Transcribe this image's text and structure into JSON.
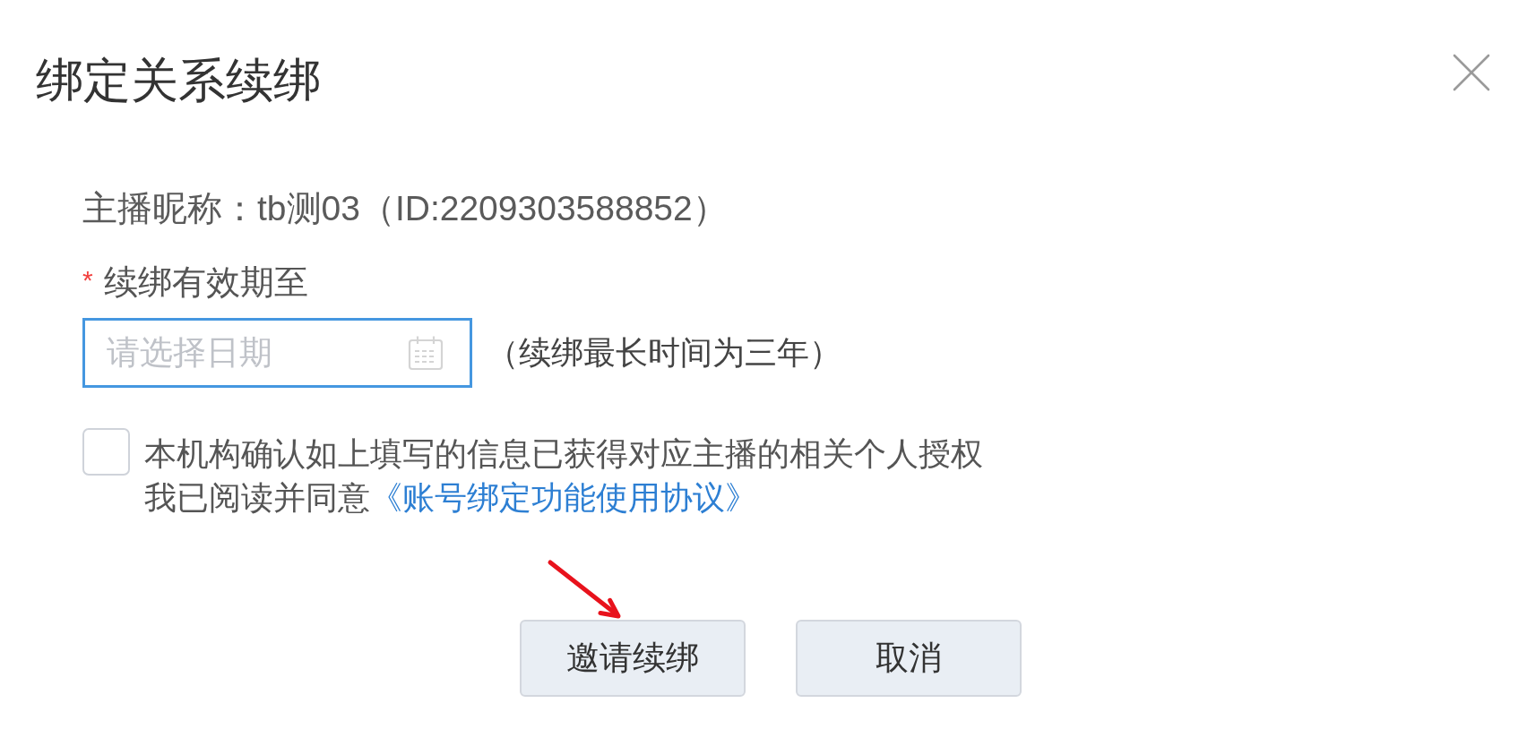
{
  "dialog": {
    "title": "绑定关系续绑"
  },
  "streamer": {
    "text": "主播昵称：tb测03（ID:2209303588852）"
  },
  "renewal_date": {
    "required_mark": "*",
    "label": "续绑有效期至",
    "placeholder": "请选择日期",
    "focused": true,
    "hint": "（续绑最长时间为三年）"
  },
  "consent": {
    "checked": false,
    "statement": "本机构确认如上填写的信息已获得对应主播的相关个人授权",
    "agreement_prefix": "我已阅读并同意",
    "agreement_link": "《账号绑定功能使用协议》"
  },
  "buttons": [
    {
      "label": "邀请续绑"
    },
    {
      "label": "取消"
    }
  ],
  "annotations": [
    {
      "kind": "arrow"
    }
  ]
}
